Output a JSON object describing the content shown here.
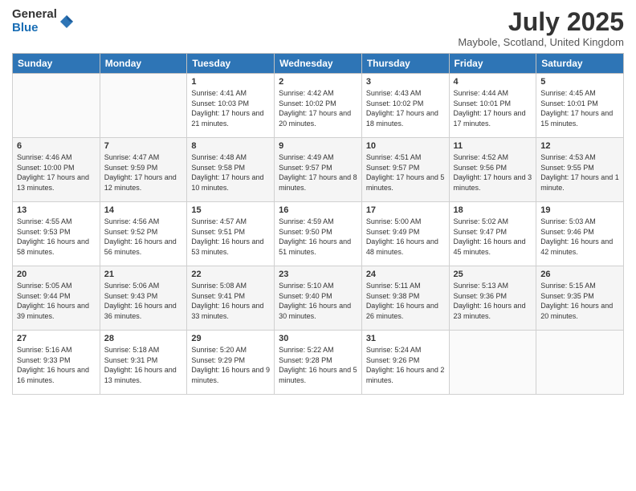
{
  "logo": {
    "general": "General",
    "blue": "Blue"
  },
  "title": "July 2025",
  "location": "Maybole, Scotland, United Kingdom",
  "days_of_week": [
    "Sunday",
    "Monday",
    "Tuesday",
    "Wednesday",
    "Thursday",
    "Friday",
    "Saturday"
  ],
  "weeks": [
    [
      {
        "day": "",
        "sunrise": "",
        "sunset": "",
        "daylight": ""
      },
      {
        "day": "",
        "sunrise": "",
        "sunset": "",
        "daylight": ""
      },
      {
        "day": "1",
        "sunrise": "Sunrise: 4:41 AM",
        "sunset": "Sunset: 10:03 PM",
        "daylight": "Daylight: 17 hours and 21 minutes."
      },
      {
        "day": "2",
        "sunrise": "Sunrise: 4:42 AM",
        "sunset": "Sunset: 10:02 PM",
        "daylight": "Daylight: 17 hours and 20 minutes."
      },
      {
        "day": "3",
        "sunrise": "Sunrise: 4:43 AM",
        "sunset": "Sunset: 10:02 PM",
        "daylight": "Daylight: 17 hours and 18 minutes."
      },
      {
        "day": "4",
        "sunrise": "Sunrise: 4:44 AM",
        "sunset": "Sunset: 10:01 PM",
        "daylight": "Daylight: 17 hours and 17 minutes."
      },
      {
        "day": "5",
        "sunrise": "Sunrise: 4:45 AM",
        "sunset": "Sunset: 10:01 PM",
        "daylight": "Daylight: 17 hours and 15 minutes."
      }
    ],
    [
      {
        "day": "6",
        "sunrise": "Sunrise: 4:46 AM",
        "sunset": "Sunset: 10:00 PM",
        "daylight": "Daylight: 17 hours and 13 minutes."
      },
      {
        "day": "7",
        "sunrise": "Sunrise: 4:47 AM",
        "sunset": "Sunset: 9:59 PM",
        "daylight": "Daylight: 17 hours and 12 minutes."
      },
      {
        "day": "8",
        "sunrise": "Sunrise: 4:48 AM",
        "sunset": "Sunset: 9:58 PM",
        "daylight": "Daylight: 17 hours and 10 minutes."
      },
      {
        "day": "9",
        "sunrise": "Sunrise: 4:49 AM",
        "sunset": "Sunset: 9:57 PM",
        "daylight": "Daylight: 17 hours and 8 minutes."
      },
      {
        "day": "10",
        "sunrise": "Sunrise: 4:51 AM",
        "sunset": "Sunset: 9:57 PM",
        "daylight": "Daylight: 17 hours and 5 minutes."
      },
      {
        "day": "11",
        "sunrise": "Sunrise: 4:52 AM",
        "sunset": "Sunset: 9:56 PM",
        "daylight": "Daylight: 17 hours and 3 minutes."
      },
      {
        "day": "12",
        "sunrise": "Sunrise: 4:53 AM",
        "sunset": "Sunset: 9:55 PM",
        "daylight": "Daylight: 17 hours and 1 minute."
      }
    ],
    [
      {
        "day": "13",
        "sunrise": "Sunrise: 4:55 AM",
        "sunset": "Sunset: 9:53 PM",
        "daylight": "Daylight: 16 hours and 58 minutes."
      },
      {
        "day": "14",
        "sunrise": "Sunrise: 4:56 AM",
        "sunset": "Sunset: 9:52 PM",
        "daylight": "Daylight: 16 hours and 56 minutes."
      },
      {
        "day": "15",
        "sunrise": "Sunrise: 4:57 AM",
        "sunset": "Sunset: 9:51 PM",
        "daylight": "Daylight: 16 hours and 53 minutes."
      },
      {
        "day": "16",
        "sunrise": "Sunrise: 4:59 AM",
        "sunset": "Sunset: 9:50 PM",
        "daylight": "Daylight: 16 hours and 51 minutes."
      },
      {
        "day": "17",
        "sunrise": "Sunrise: 5:00 AM",
        "sunset": "Sunset: 9:49 PM",
        "daylight": "Daylight: 16 hours and 48 minutes."
      },
      {
        "day": "18",
        "sunrise": "Sunrise: 5:02 AM",
        "sunset": "Sunset: 9:47 PM",
        "daylight": "Daylight: 16 hours and 45 minutes."
      },
      {
        "day": "19",
        "sunrise": "Sunrise: 5:03 AM",
        "sunset": "Sunset: 9:46 PM",
        "daylight": "Daylight: 16 hours and 42 minutes."
      }
    ],
    [
      {
        "day": "20",
        "sunrise": "Sunrise: 5:05 AM",
        "sunset": "Sunset: 9:44 PM",
        "daylight": "Daylight: 16 hours and 39 minutes."
      },
      {
        "day": "21",
        "sunrise": "Sunrise: 5:06 AM",
        "sunset": "Sunset: 9:43 PM",
        "daylight": "Daylight: 16 hours and 36 minutes."
      },
      {
        "day": "22",
        "sunrise": "Sunrise: 5:08 AM",
        "sunset": "Sunset: 9:41 PM",
        "daylight": "Daylight: 16 hours and 33 minutes."
      },
      {
        "day": "23",
        "sunrise": "Sunrise: 5:10 AM",
        "sunset": "Sunset: 9:40 PM",
        "daylight": "Daylight: 16 hours and 30 minutes."
      },
      {
        "day": "24",
        "sunrise": "Sunrise: 5:11 AM",
        "sunset": "Sunset: 9:38 PM",
        "daylight": "Daylight: 16 hours and 26 minutes."
      },
      {
        "day": "25",
        "sunrise": "Sunrise: 5:13 AM",
        "sunset": "Sunset: 9:36 PM",
        "daylight": "Daylight: 16 hours and 23 minutes."
      },
      {
        "day": "26",
        "sunrise": "Sunrise: 5:15 AM",
        "sunset": "Sunset: 9:35 PM",
        "daylight": "Daylight: 16 hours and 20 minutes."
      }
    ],
    [
      {
        "day": "27",
        "sunrise": "Sunrise: 5:16 AM",
        "sunset": "Sunset: 9:33 PM",
        "daylight": "Daylight: 16 hours and 16 minutes."
      },
      {
        "day": "28",
        "sunrise": "Sunrise: 5:18 AM",
        "sunset": "Sunset: 9:31 PM",
        "daylight": "Daylight: 16 hours and 13 minutes."
      },
      {
        "day": "29",
        "sunrise": "Sunrise: 5:20 AM",
        "sunset": "Sunset: 9:29 PM",
        "daylight": "Daylight: 16 hours and 9 minutes."
      },
      {
        "day": "30",
        "sunrise": "Sunrise: 5:22 AM",
        "sunset": "Sunset: 9:28 PM",
        "daylight": "Daylight: 16 hours and 5 minutes."
      },
      {
        "day": "31",
        "sunrise": "Sunrise: 5:24 AM",
        "sunset": "Sunset: 9:26 PM",
        "daylight": "Daylight: 16 hours and 2 minutes."
      },
      {
        "day": "",
        "sunrise": "",
        "sunset": "",
        "daylight": ""
      },
      {
        "day": "",
        "sunrise": "",
        "sunset": "",
        "daylight": ""
      }
    ]
  ]
}
